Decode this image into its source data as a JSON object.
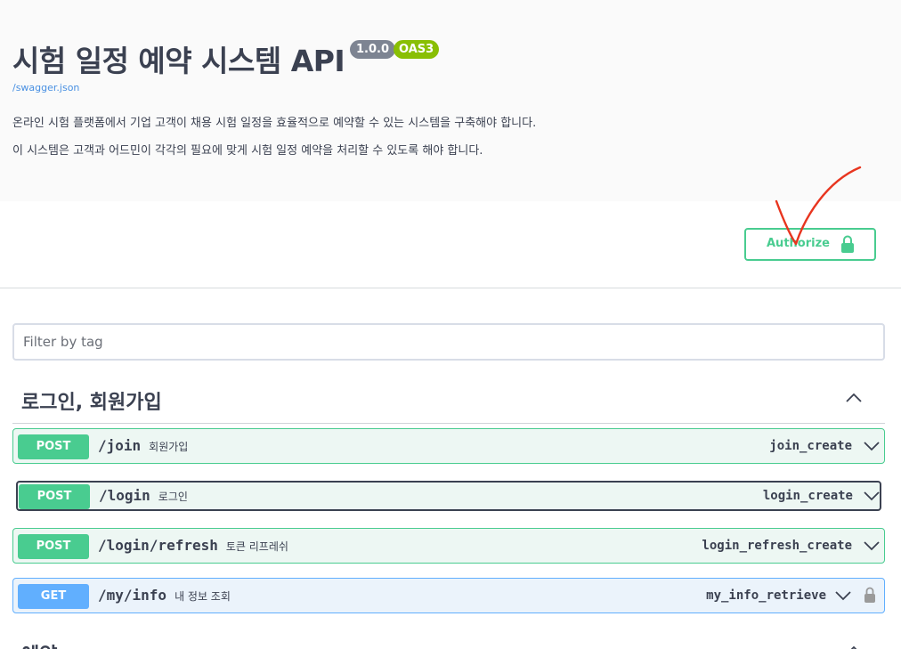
{
  "info": {
    "title": "시험 일정 예약 시스템 API",
    "version": "1.0.0",
    "oas": "OAS3",
    "spec_link": "/swagger.json",
    "description": [
      "온라인 시험 플랫폼에서 기업 고객이 채용 시험 일정을 효율적으로 예약할 수 있는 시스템을 구축해야 합니다.",
      "이 시스템은 고객과 어드민이 각각의 필요에 맞게 시험 일정 예약을 처리할 수 있도록 해야 합니다."
    ]
  },
  "authorize": {
    "label": "Authorize"
  },
  "filter": {
    "placeholder": "Filter by tag"
  },
  "tags": [
    {
      "name": "로그인, 회원가입",
      "operations": [
        {
          "method": "POST",
          "path": "/join",
          "summary": "회원가입",
          "operation_id": "join_create"
        },
        {
          "method": "POST",
          "path": "/login",
          "summary": "로그인",
          "operation_id": "login_create"
        },
        {
          "method": "POST",
          "path": "/login/refresh",
          "summary": "토큰 리프레쉬",
          "operation_id": "login_refresh_create"
        },
        {
          "method": "GET",
          "path": "/my/info",
          "summary": "내 정보 조회",
          "operation_id": "my_info_retrieve"
        }
      ]
    },
    {
      "name": "예약"
    }
  ],
  "colors": {
    "post": "#49cc90",
    "get": "#61affe",
    "annotation": "#e8351f"
  }
}
